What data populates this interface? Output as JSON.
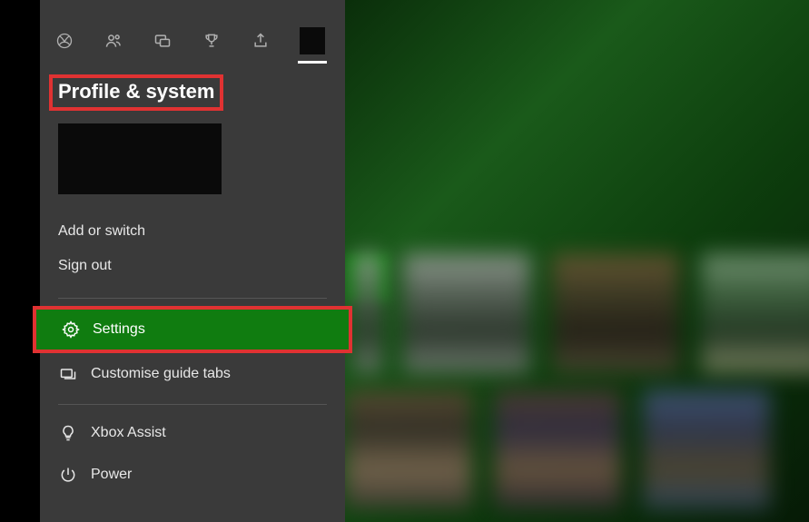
{
  "tabs": {
    "xbox": "xbox-icon",
    "people": "people-icon",
    "chat": "chat-icon",
    "achievements": "trophy-icon",
    "share": "share-icon",
    "profile": "profile-icon"
  },
  "panel": {
    "title": "Profile & system"
  },
  "account_menu": {
    "add_or_switch": "Add or switch",
    "sign_out": "Sign out"
  },
  "system_menu": {
    "settings": "Settings",
    "customise_guide_tabs": "Customise guide tabs",
    "xbox_assist": "Xbox Assist",
    "power": "Power"
  },
  "colors": {
    "highlight": "#e03232",
    "selected": "#107c10",
    "panel_bg": "#3a3a3a"
  }
}
